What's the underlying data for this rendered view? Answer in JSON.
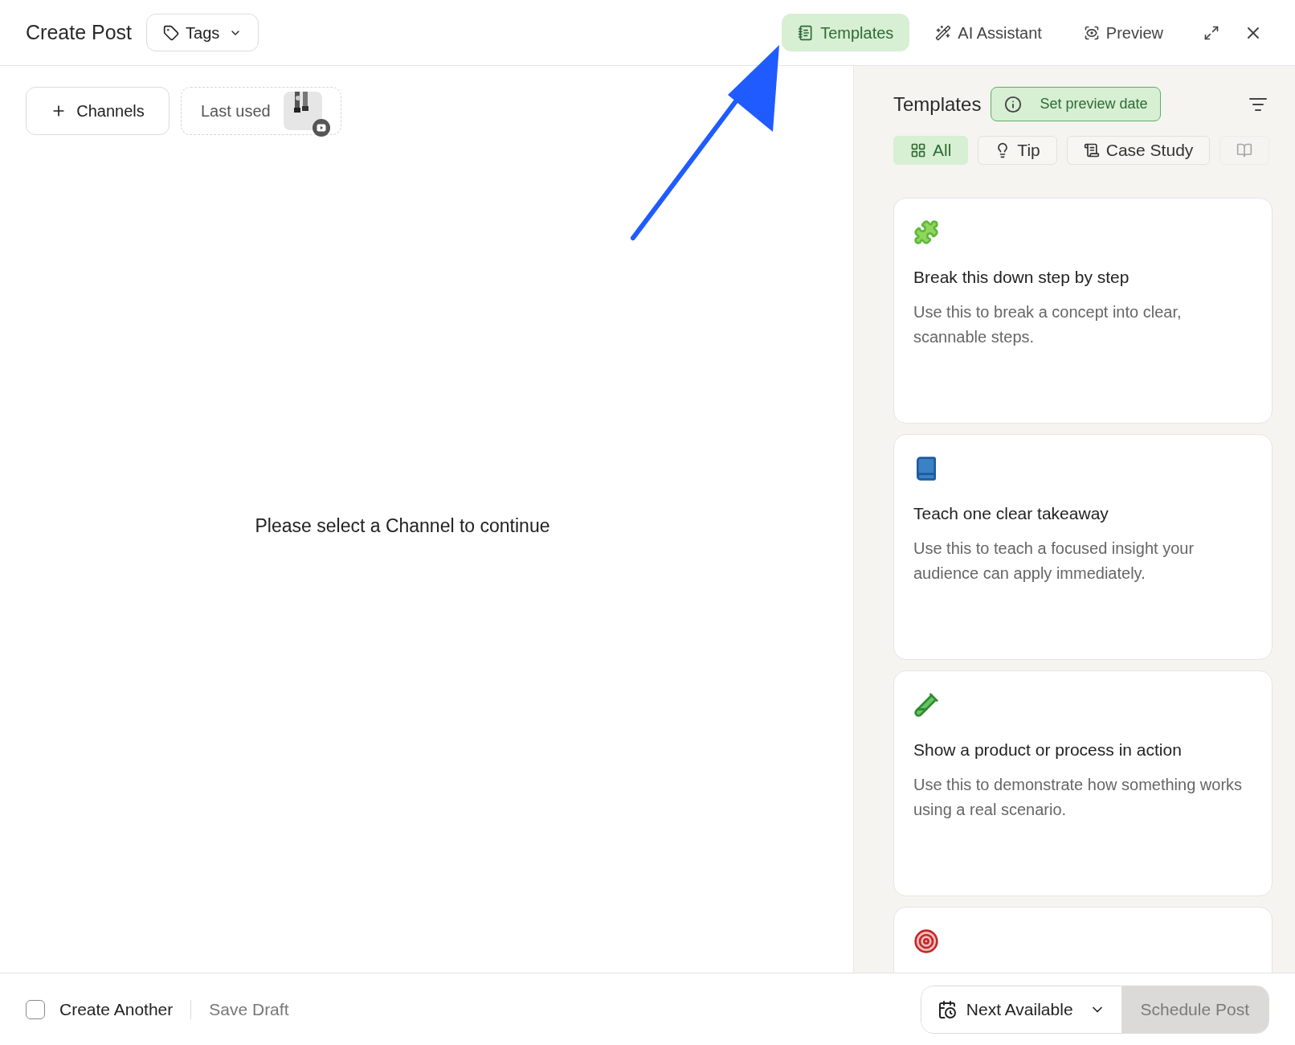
{
  "header": {
    "title": "Create Post",
    "tags_button": "Tags",
    "toolbar": [
      {
        "label": "Templates",
        "kind": "templates",
        "selected": true
      },
      {
        "label": "AI Assistant",
        "kind": "ai",
        "selected": false
      },
      {
        "label": "Preview",
        "kind": "preview",
        "selected": false
      }
    ]
  },
  "channels": {
    "add_button": "Channels",
    "last_used": "Last used"
  },
  "empty_message": "Please select a Channel to continue",
  "templates_panel": {
    "title": "Templates",
    "preview_date_button": "Set preview date",
    "filters": [
      {
        "label": "All",
        "kind": "all",
        "selected": true
      },
      {
        "label": "Tip",
        "kind": "tip",
        "selected": false
      },
      {
        "label": "Case Study",
        "kind": "case",
        "selected": false
      },
      {
        "kind": "book",
        "selected": false
      }
    ],
    "cards": [
      {
        "kind": "puzzle",
        "title": "Break this down step by step",
        "description": "Use this to break a concept into clear, scannable steps."
      },
      {
        "kind": "book",
        "title": "Teach one clear takeaway",
        "description": "Use this to teach a focused insight your audience can apply immediately."
      },
      {
        "kind": "testtube",
        "title": "Show a product or process in action",
        "description": "Use this to demonstrate how something works using a real scenario."
      },
      {
        "kind": "target"
      }
    ]
  },
  "footer": {
    "create_another": {
      "label": "Create Another",
      "checked": false
    },
    "save_draft": "Save Draft",
    "schedule_menu": "Next Available",
    "schedule_button": {
      "label": "Schedule Post",
      "disabled": true
    }
  }
}
